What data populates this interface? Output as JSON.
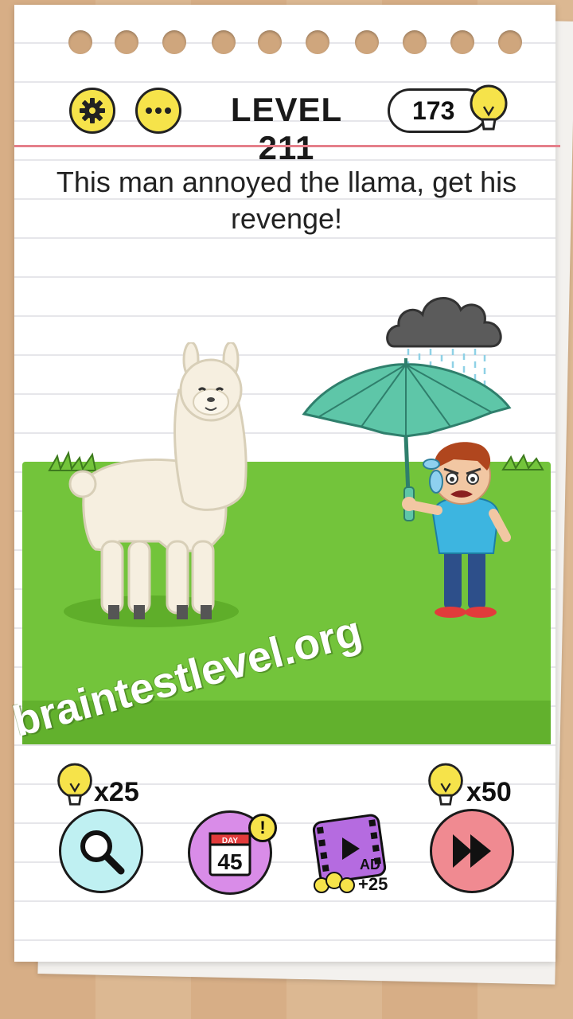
{
  "header": {
    "level_label": "LEVEL 211",
    "hint_count": "173",
    "settings_icon": "gear-icon",
    "menu_icon": "more-dots-icon"
  },
  "question": "This man annoyed the llama, get his revenge!",
  "watermark": "braintestlevel.org",
  "bottom_bar": {
    "search_cost": "x25",
    "calendar_day_label": "DAY",
    "calendar_day": "45",
    "calendar_badge": "!",
    "ad_label": "AD",
    "ad_bonus": "+25",
    "skip_cost": "x50"
  },
  "colors": {
    "accent_yellow": "#f6e34a",
    "grass": "#73c43b",
    "search_btn": "#bff0f2",
    "calendar_btn": "#d98ce8",
    "skip_btn": "#f08a91",
    "margin_line": "#e57f8a"
  }
}
